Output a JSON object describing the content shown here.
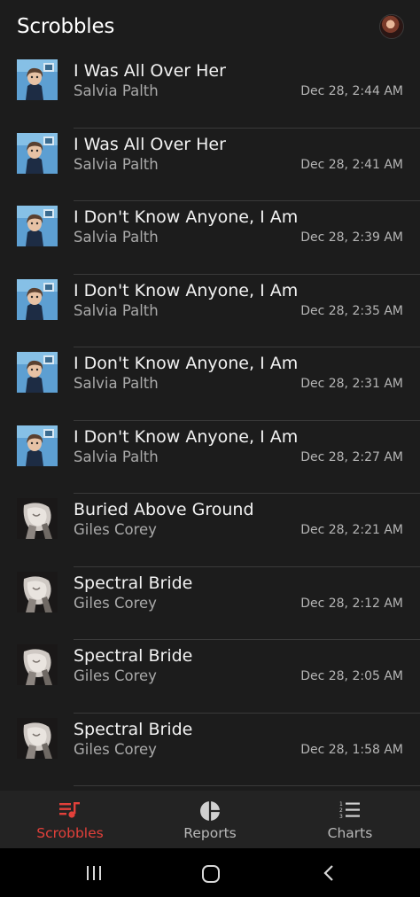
{
  "header": {
    "title": "Scrobbles"
  },
  "scrobbles": [
    {
      "track": "I Was All Over Her",
      "artist": "Salvia Palth",
      "time": "Dec 28, 2:44 AM",
      "art": "salvia"
    },
    {
      "track": "I Was All Over Her",
      "artist": "Salvia Palth",
      "time": "Dec 28, 2:41 AM",
      "art": "salvia"
    },
    {
      "track": "I Don't Know Anyone, I Am",
      "artist": "Salvia Palth",
      "time": "Dec 28, 2:39 AM",
      "art": "salvia"
    },
    {
      "track": "I Don't Know Anyone, I Am",
      "artist": "Salvia Palth",
      "time": "Dec 28, 2:35 AM",
      "art": "salvia"
    },
    {
      "track": "I Don't Know Anyone, I Am",
      "artist": "Salvia Palth",
      "time": "Dec 28, 2:31 AM",
      "art": "salvia"
    },
    {
      "track": "I Don't Know Anyone, I Am",
      "artist": "Salvia Palth",
      "time": "Dec 28, 2:27 AM",
      "art": "salvia"
    },
    {
      "track": "Buried Above Ground",
      "artist": "Giles Corey",
      "time": "Dec 28, 2:21 AM",
      "art": "giles"
    },
    {
      "track": "Spectral Bride",
      "artist": "Giles Corey",
      "time": "Dec 28, 2:12 AM",
      "art": "giles"
    },
    {
      "track": "Spectral Bride",
      "artist": "Giles Corey",
      "time": "Dec 28, 2:05 AM",
      "art": "giles"
    },
    {
      "track": "Spectral Bride",
      "artist": "Giles Corey",
      "time": "Dec 28, 1:58 AM",
      "art": "giles"
    }
  ],
  "nav": {
    "scrobbles": "Scrobbles",
    "reports": "Reports",
    "charts": "Charts",
    "active": "scrobbles"
  },
  "icons": {
    "header_avatar": "avatar",
    "nav_scrobbles": "music-list-icon",
    "nav_reports": "pie-chart-icon",
    "nav_charts": "numbered-list-icon",
    "system_recents": "recents-icon",
    "system_home": "home-icon",
    "system_back": "back-icon"
  },
  "colors": {
    "background": "#1c1c1c",
    "accent": "#e2403a",
    "nav_background": "#232323",
    "divider": "#3a3a3a"
  }
}
